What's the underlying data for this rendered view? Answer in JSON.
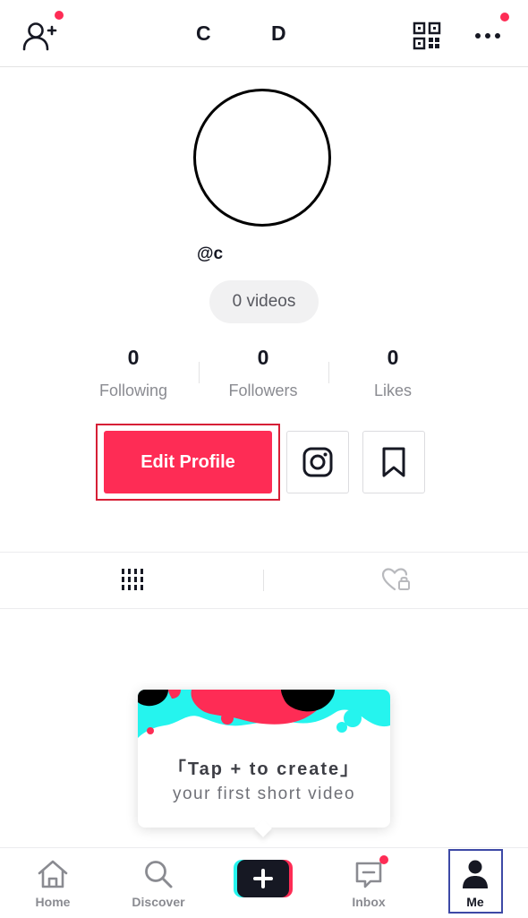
{
  "header": {
    "left_letter": "C",
    "right_letter": "D"
  },
  "profile": {
    "username": "@c",
    "videos": "0 videos"
  },
  "stats": [
    {
      "value": "0",
      "label": "Following"
    },
    {
      "value": "0",
      "label": "Followers"
    },
    {
      "value": "0",
      "label": "Likes"
    }
  ],
  "actions": {
    "edit_profile": "Edit Profile"
  },
  "create_card": {
    "line1": "「Tap + to create」",
    "line2": "your first short video"
  },
  "bottom_nav": {
    "home": "Home",
    "discover": "Discover",
    "inbox": "Inbox",
    "me": "Me"
  },
  "colors": {
    "accent": "#fe2c55",
    "cyan": "#25f4ee",
    "selected_outline": "#3d49a6",
    "highlight_outline": "#d61f36"
  }
}
